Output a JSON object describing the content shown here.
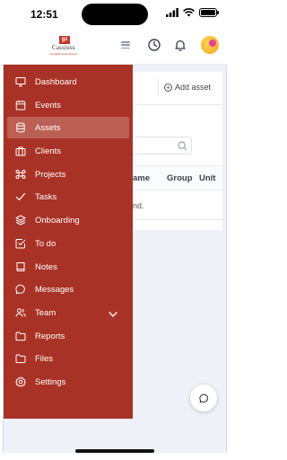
{
  "status_bar": {
    "time": "12:51"
  },
  "brand": {
    "logo_mark": "gz",
    "logo_name": "Cassiuss",
    "logo_tagline": "Tangible Assets Portal",
    "accent": "#a93226"
  },
  "header": {
    "menu_icon": "hamburger-icon",
    "icons": [
      "clock-icon",
      "bell-icon",
      "avatar"
    ]
  },
  "main": {
    "add_button_label": "Add asset",
    "table_headers": [
      "ame",
      "Group",
      "Unit"
    ],
    "empty_text": "nd."
  },
  "sidebar": {
    "items": [
      {
        "label": "Dashboard",
        "icon": "monitor-icon",
        "active": false
      },
      {
        "label": "Events",
        "icon": "calendar-icon",
        "active": false
      },
      {
        "label": "Assets",
        "icon": "database-icon",
        "active": true
      },
      {
        "label": "Clients",
        "icon": "briefcase-icon",
        "active": false
      },
      {
        "label": "Projects",
        "icon": "command-icon",
        "active": false
      },
      {
        "label": "Tasks",
        "icon": "check-icon",
        "active": false
      },
      {
        "label": "Onboarding",
        "icon": "layers-icon",
        "active": false
      },
      {
        "label": "To do",
        "icon": "check-square-icon",
        "active": false
      },
      {
        "label": "Notes",
        "icon": "book-icon",
        "active": false
      },
      {
        "label": "Messages",
        "icon": "message-circle-icon",
        "active": false
      },
      {
        "label": "Team",
        "icon": "users-icon",
        "active": false,
        "has_submenu": true
      },
      {
        "label": "Reports",
        "icon": "folder-icon",
        "active": false
      },
      {
        "label": "Files",
        "icon": "folder-icon",
        "active": false
      },
      {
        "label": "Settings",
        "icon": "gear-icon",
        "active": false
      }
    ]
  },
  "chat": {
    "icon": "chat-icon"
  }
}
